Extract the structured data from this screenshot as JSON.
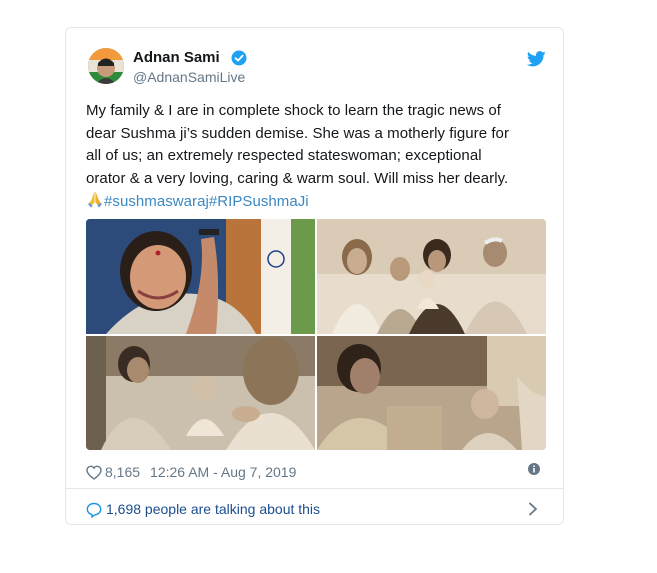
{
  "tweet": {
    "author_name": "Adnan Sami",
    "handle": "@AdnanSamiLive",
    "text_lines": [
      "My family & I are in complete shock to learn the tragic news of",
      "dear Sushma ji’s sudden demise. She was a motherly figure for",
      "all of us; an extremely respected stateswoman; exceptional",
      "orator & a very loving, caring & warm soul. Will miss her dearly."
    ],
    "emoji": "folded-hands",
    "hashtags": [
      "#sushmaswaraj",
      "#RIPSushmaJi"
    ],
    "likes": "8,165",
    "timestamp": "12:26 AM - Aug 7, 2019",
    "talking": "1,698 people are talking about this"
  },
  "colors": {
    "link": "#3b88c3",
    "text": "#14171a",
    "muted": "#657786",
    "border": "#e1e8ed",
    "twitter_blue": "#1da1f2"
  },
  "icons": [
    "verified-badge-icon",
    "twitter-bird-icon",
    "heart-icon",
    "info-icon",
    "speech-bubble-icon",
    "chevron-right-icon"
  ]
}
